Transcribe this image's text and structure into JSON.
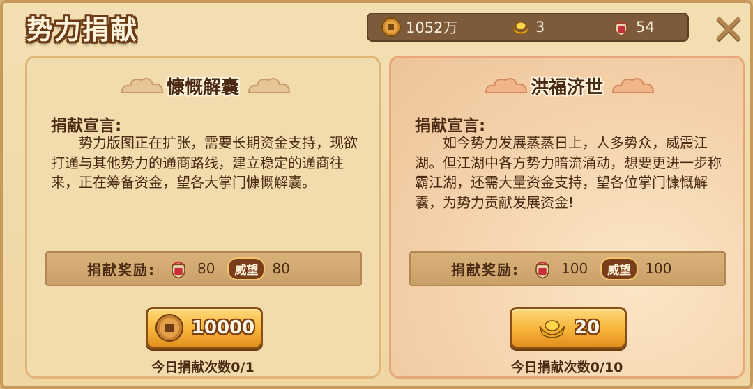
{
  "header": {
    "title": "势力捐献",
    "coins": "1052万",
    "ingots": "3",
    "bags": "54",
    "coin_icon": "copper-coin-icon",
    "ingot_icon": "gold-ingot-icon",
    "bag_icon": "red-pouch-icon",
    "close_icon": "close-x-icon"
  },
  "panels": [
    {
      "title": "慷慨解囊",
      "declaration_heading": "捐献宣言:",
      "declaration": "势力版图正在扩张，需要长期资金支持，现欲打通与其他势力的通商路线，建立稳定的通商往来，正在筹备资金，望各大掌门慷慨解囊。",
      "reward_label": "捐献奖励:",
      "reward_bag": "80",
      "reward_badge": "威望",
      "reward_prestige": "80",
      "button_cost": "10000",
      "button_icon": "copper-coin-icon",
      "count": "今日捐献次数0/1"
    },
    {
      "title": "洪福济世",
      "declaration_heading": "捐献宣言:",
      "declaration": "如今势力发展蒸蒸日上，人多势众，威震江湖。但江湖中各方势力暗流涌动，想要更进一步称霸江湖，还需大量资金支持，望各位掌门慷慨解囊，为势力贡献发展资金!",
      "reward_label": "捐献奖励:",
      "reward_bag": "100",
      "reward_badge": "威望",
      "reward_prestige": "100",
      "button_cost": "20",
      "button_icon": "gold-ingot-icon",
      "count": "今日捐献次数0/10"
    }
  ],
  "colors": {
    "frame_bg": "#efd6a2",
    "text_dark": "#4a2a12",
    "button_gold": "#f7b43a",
    "resource_bar": "#7d5a3a"
  }
}
